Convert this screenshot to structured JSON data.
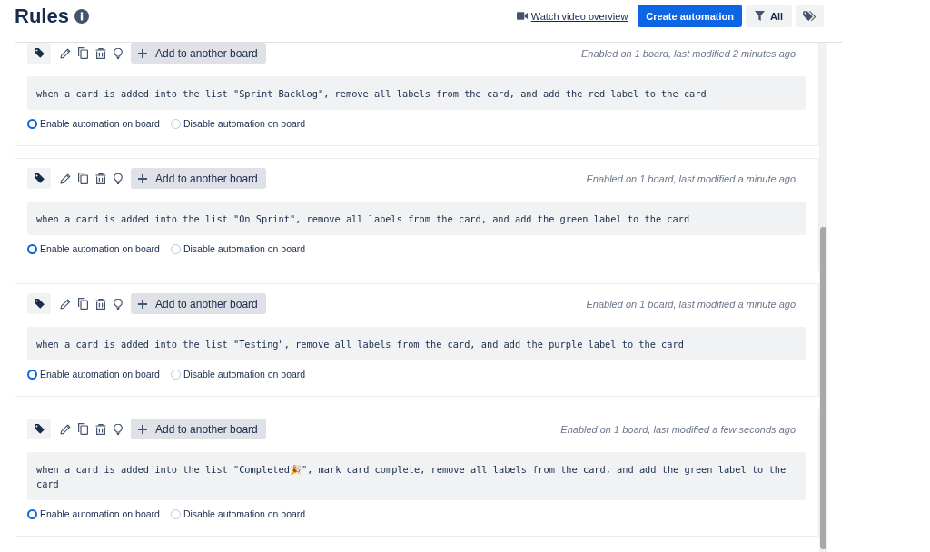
{
  "header": {
    "title": "Rules",
    "video_link": "Watch video overview",
    "create_button": "Create automation",
    "filter_button": "All"
  },
  "rules": [
    {
      "add_button": "Add to another board",
      "status": "Enabled on 1 board, last modified 2 minutes ago",
      "text": "when a card is added into the list \"Sprint Backlog\", remove all labels from the card, and add the red label to the card",
      "options": [
        {
          "label": "Enable automation on board",
          "selected": true
        },
        {
          "label": "Disable automation on board",
          "selected": false
        }
      ]
    },
    {
      "add_button": "Add to another board",
      "status": "Enabled on 1 board, last modified a minute ago",
      "text": "when a card is added into the list \"On Sprint\", remove all labels from the card, and add the green label to the card",
      "options": [
        {
          "label": "Enable automation on board",
          "selected": true
        },
        {
          "label": "Disable automation on board",
          "selected": false
        }
      ]
    },
    {
      "add_button": "Add to another board",
      "status": "Enabled on 1 board, last modified a minute ago",
      "text": "when a card is added into the list \"Testing\", remove all labels from the card, and add the purple label to the card",
      "options": [
        {
          "label": "Enable automation on board",
          "selected": true
        },
        {
          "label": "Disable automation on board",
          "selected": false
        }
      ]
    },
    {
      "add_button": "Add to another board",
      "status": "Enabled on 1 board, last modified a few seconds ago",
      "text": "when a card is added into the list \"Completed🎉\", mark card complete, remove all labels from the card, and add the green label to the card",
      "options": [
        {
          "label": "Enable automation on board",
          "selected": true
        },
        {
          "label": "Disable automation on board",
          "selected": false
        }
      ]
    }
  ]
}
